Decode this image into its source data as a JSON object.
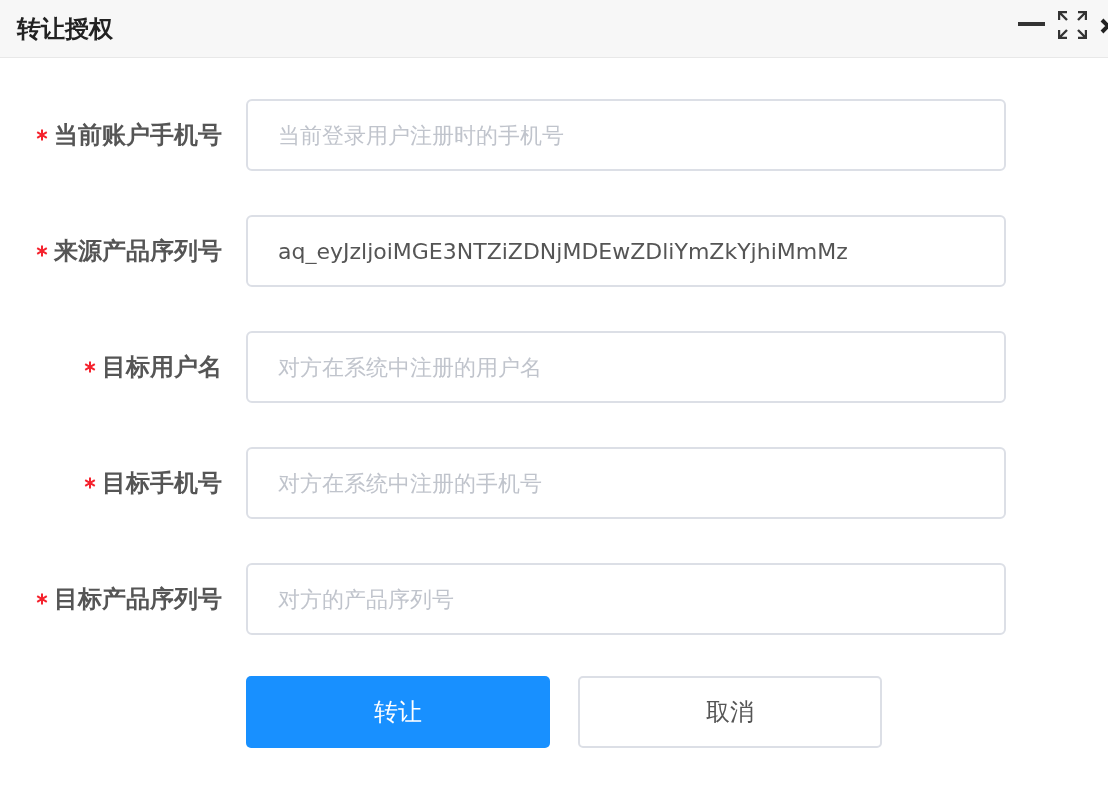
{
  "window": {
    "title": "转让授权"
  },
  "fields": [
    {
      "label": "当前账户手机号",
      "required": true,
      "placeholder": "当前登录用户注册时的手机号"
    },
    {
      "label": "来源产品序列号",
      "required": true,
      "value": "aq_eyJzljoiMGE3NTZiZDNjMDEwZDliYmZkYjhiMmMz"
    },
    {
      "label": "目标用户名",
      "required": true,
      "placeholder": "对方在系统中注册的用户名"
    },
    {
      "label": "目标手机号",
      "required": true,
      "placeholder": "对方在系统中注册的手机号"
    },
    {
      "label": "目标产品序列号",
      "required": true,
      "placeholder": "对方的产品序列号"
    }
  ],
  "buttons": [
    {
      "label": "转让",
      "kind": "primary"
    },
    {
      "label": "取消",
      "kind": "default"
    }
  ]
}
